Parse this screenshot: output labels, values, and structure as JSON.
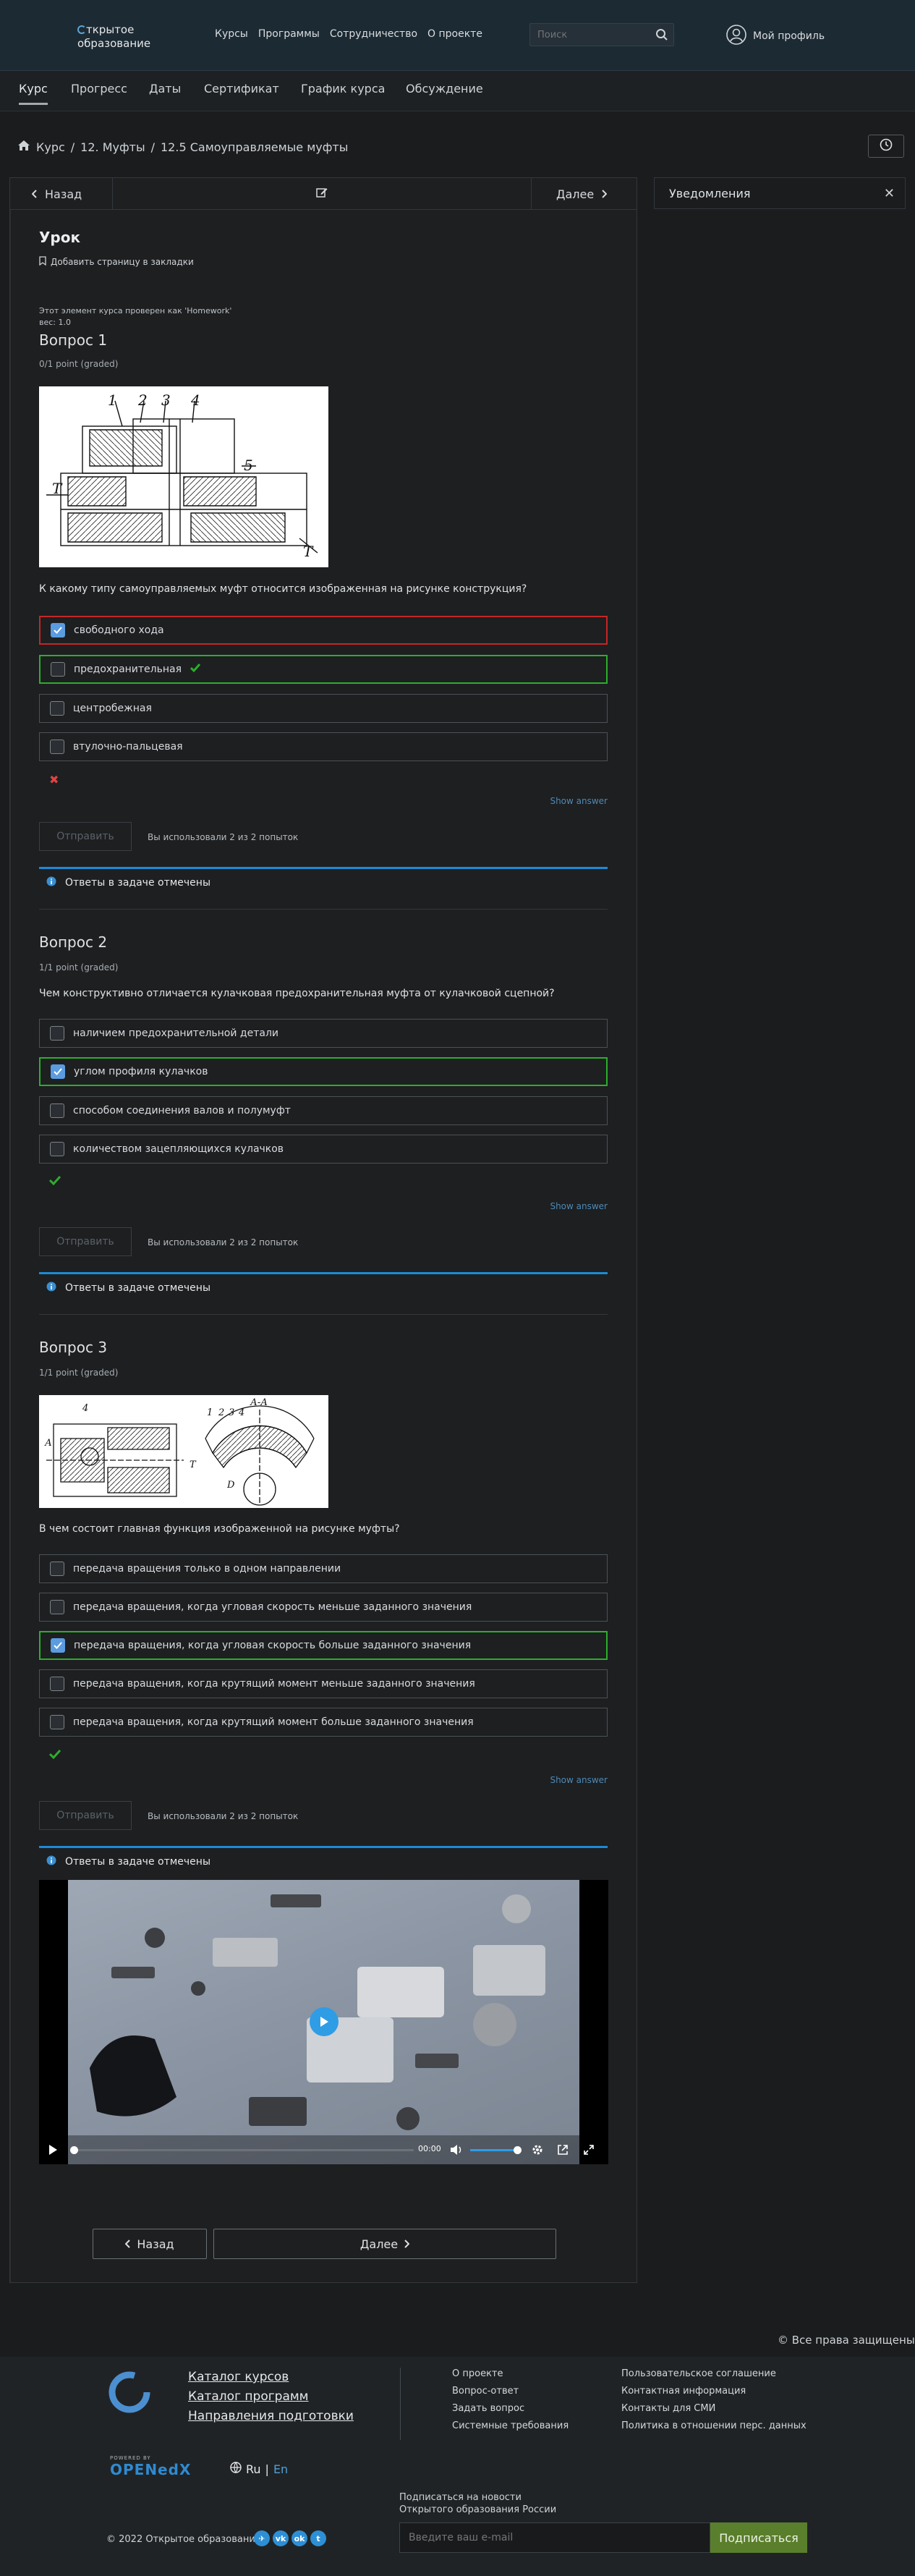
{
  "header": {
    "logo_line1": "ткрытое",
    "logo_line2": "образование",
    "nav": [
      "Курсы",
      "Программы",
      "Сотрудничество",
      "О проекте"
    ],
    "search_placeholder": "Поиск",
    "profile_label": "Мой профиль"
  },
  "course_tabs": [
    {
      "label": "Курс",
      "active": true
    },
    {
      "label": "Прогресс",
      "active": false
    },
    {
      "label": "Даты",
      "active": false
    },
    {
      "label": "Сертификат",
      "active": false
    },
    {
      "label": "График курса",
      "active": false
    },
    {
      "label": "Обсуждение",
      "active": false
    }
  ],
  "breadcrumb": [
    "Курс",
    "12. Муфты",
    "12.5 Самоуправляемые муфты"
  ],
  "sequence_nav": {
    "prev": "Назад",
    "next": "Далее"
  },
  "unit": {
    "title": "Урок",
    "bookmark": "Добавить страницу в закладки",
    "homework_note": "Этот элемент курса проверен как 'Homework'",
    "weight": "вес: 1.0"
  },
  "questions": [
    {
      "title": "Вопрос 1",
      "points": "0/1 point (graded)",
      "text": "К какому типу самоуправляемых муфт относится изображенная на рисунке конструкция?",
      "options": [
        {
          "label": "свободного хода",
          "checked": true,
          "state": "incorrect"
        },
        {
          "label": "предохранительная",
          "checked": false,
          "state": "correct"
        },
        {
          "label": "центробежная",
          "checked": false,
          "state": "none"
        },
        {
          "label": "втулочно-пальцевая",
          "checked": false,
          "state": "none"
        }
      ],
      "result": "incorrect",
      "show_answer": "Show answer",
      "submit": "Отправить",
      "attempts": "Вы использовали 2 из 2 попыток",
      "notice": "Ответы в задаче отмечены"
    },
    {
      "title": "Вопрос 2",
      "points": "1/1 point (graded)",
      "text": "Чем конструктивно отличается кулачковая предохранительная муфта от кулачковой сцепной?",
      "options": [
        {
          "label": "наличием предохранительной детали",
          "checked": false,
          "state": "none"
        },
        {
          "label": "углом профиля кулачков",
          "checked": true,
          "state": "correct"
        },
        {
          "label": "способом соединения валов и полумуфт",
          "checked": false,
          "state": "none"
        },
        {
          "label": "количеством зацепляющихся кулачков",
          "checked": false,
          "state": "none"
        }
      ],
      "result": "correct",
      "show_answer": "Show answer",
      "submit": "Отправить",
      "attempts": "Вы использовали 2 из 2 попыток",
      "notice": "Ответы в задаче отмечены"
    },
    {
      "title": "Вопрос 3",
      "points": "1/1 point (graded)",
      "text": "В чем состоит главная функция изображенной на рисунке муфты?",
      "options": [
        {
          "label": "передача вращения только в одном направлении",
          "checked": false,
          "state": "none"
        },
        {
          "label": "передача вращения, когда угловая скорость меньше заданного значения",
          "checked": false,
          "state": "none"
        },
        {
          "label": "передача вращения, когда угловая скорость больше заданного значения",
          "checked": true,
          "state": "correct"
        },
        {
          "label": "передача вращения, когда крутящий момент меньше заданного значения",
          "checked": false,
          "state": "none"
        },
        {
          "label": "передача вращения, когда крутящий момент больше заданного значения",
          "checked": false,
          "state": "none"
        }
      ],
      "result": "correct",
      "show_answer": "Show answer",
      "submit": "Отправить",
      "attempts": "Вы использовали 2 из 2 попыток",
      "notice": "Ответы в задаче отмечены"
    }
  ],
  "figure1_labels": {
    "l1": "1",
    "l2": "2",
    "l3": "3",
    "l4": "4",
    "l5": "5",
    "t1": "T",
    "t2": "T"
  },
  "figure3_labels": {
    "left_top": "4",
    "sec": "А-А",
    "n1": "1",
    "n2": "2",
    "n3": "3",
    "n4": "4",
    "t": "T",
    "a": "А",
    "d": "D"
  },
  "video": {
    "time": "00:00",
    "progress": 0.0,
    "volume": 0.8
  },
  "bottom_nav": {
    "prev": "Назад",
    "next": "Далее"
  },
  "notifications": {
    "title": "Уведомления"
  },
  "rights": "© Все права защищены",
  "footer": {
    "links": [
      "Каталог курсов",
      "Каталог программ",
      "Направления подготовки"
    ],
    "col1": [
      "О проекте",
      "Вопрос-ответ",
      "Задать вопрос",
      "Системные требования"
    ],
    "col2": [
      "Пользовательское соглашение",
      "Контактная информация",
      "Контакты для СМИ",
      "Политика в отношении перс. данных"
    ],
    "openedx_small": "POWERED BY",
    "openedx": "OPENedX",
    "lang_ru": "Ru",
    "lang_en": "En",
    "subscribe_line1": "Подписаться на новости",
    "subscribe_line2": "Открытого образования России",
    "email_placeholder": "Введите ваш e-mail",
    "subscribe_button": "Подписаться",
    "copyright": "© 2022 Открытое образование"
  },
  "colors": {
    "accent_blue": "#1d8ad6",
    "correct": "#2cae2c",
    "incorrect": "#c52626",
    "subscribe": "#5a7f2c"
  }
}
